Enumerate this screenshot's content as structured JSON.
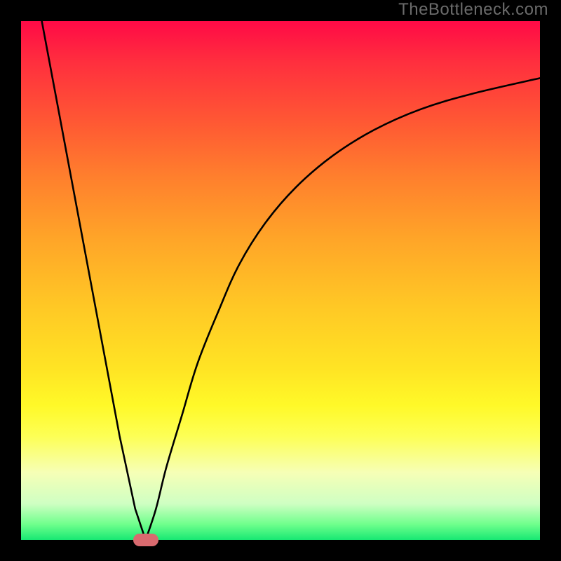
{
  "watermark": "TheBottleneck.com",
  "chart_data": {
    "type": "line",
    "title": "",
    "xlabel": "",
    "ylabel": "",
    "xlim": [
      0,
      100
    ],
    "ylim": [
      0,
      100
    ],
    "grid": false,
    "legend": false,
    "gradient_background": {
      "top": "#ff0a46",
      "mid": "#ffe424",
      "bottom": "#17e873"
    },
    "series": [
      {
        "name": "left-branch",
        "x": [
          4,
          7,
          10,
          13,
          16,
          19,
          22,
          24
        ],
        "y": [
          100,
          84,
          68,
          52,
          36,
          20,
          6,
          0
        ]
      },
      {
        "name": "right-branch",
        "x": [
          24,
          26,
          28,
          31,
          34,
          38,
          42,
          47,
          53,
          60,
          68,
          77,
          87,
          100
        ],
        "y": [
          0,
          6,
          14,
          24,
          34,
          44,
          53,
          61,
          68,
          74,
          79,
          83,
          86,
          89
        ]
      }
    ],
    "marker": {
      "x": 24,
      "y": 0,
      "color": "#d96a6f"
    }
  }
}
